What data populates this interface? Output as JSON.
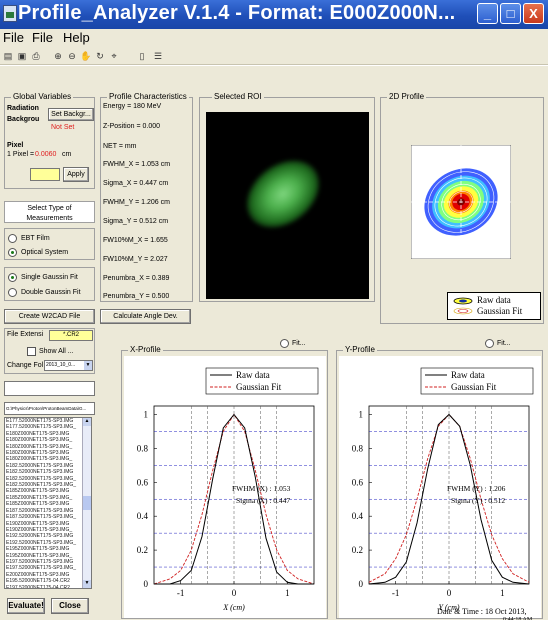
{
  "window": {
    "title": "Profile_Analyzer V.1.4 - Format: E000Z000N...",
    "buttons": [
      "_",
      "□",
      "X"
    ]
  },
  "menu": [
    "File",
    "File",
    "Help"
  ],
  "toolbar_icons": [
    "open-icon",
    "save-icon",
    "print-icon",
    "zoom-in-icon",
    "zoom-out-icon",
    "pan-icon",
    "rotate-icon",
    "data-cursor-icon",
    "colorbar-icon",
    "legend-icon"
  ],
  "global_vars": {
    "title": "Global Variables",
    "radiation": "Radiation",
    "background": "Backgrou",
    "set_bkg_btn": "Set Backgr...",
    "not_set": "Not Set",
    "pixel_label": "Pixel",
    "pixel_size_prefix": "1 Pixel = ",
    "pixel_size_value": "0.0060",
    "pixel_size_unit": "cm",
    "apply_btn": "Apply"
  },
  "measurement": {
    "title": "Select Type of Measurements",
    "ebt": "EBT Film",
    "optical": "Optical System",
    "single": "Single Gaussin Fit",
    "double": "Double Gaussin Fit"
  },
  "buttons": {
    "create_w2cad": "Create W2CAD File",
    "calc_angle": "Calculate Angle Dev.",
    "evaluate": "Evaluate!",
    "close": "Close"
  },
  "file_panel": {
    "ext_label": "File Extensi",
    "ext_value": "*.CR2",
    "show_all": "Show All ...",
    "change_folder": "Change Fol",
    "folder_value": "2013_10_0...",
    "path": "G:\\Physics\\Proton\\ProtonBeamData\\G...",
    "files": [
      "E177.52000NET175-SP3.IMG",
      "E177.52000NET175-SP3.IMG_",
      "E180Z000NET175-SP3.IMG",
      "E180Z000NET175-SP3.IMG_",
      "E180Z000NET175-SP3.IMG_",
      "E180Z000NET175-SP3.IMG",
      "E180Z000NET175-SP3.IMG_",
      "E182.52000NET175-SP3.IMG",
      "E182.52000NET175-SP3.IMG",
      "E182.52000NET175-SP3.IMG_",
      "E182.52000NET175-SP3.IMG_",
      "E185Z000NET175-SP3.IMG",
      "E185Z000NET175-SP3.IMG_",
      "E185Z000NET175-SP3.IMG",
      "E187.52000NET175-SP3.IMG",
      "E187.52000NET175-SP3.IMG_",
      "E190Z000NET175-SP3.IMG",
      "E190Z000NET175-SP3.IMG_",
      "E192.52000NET175-SP3.IMG",
      "E192.52000NET175-SP3.IMG_",
      "E195Z000NET175-SP3.IMG",
      "E195Z000NET175-SP3.IMG_",
      "E197.52000NET175-SP3.IMG",
      "E197.52000NET175-SP3.IMG_",
      "E200Z000NET175-SP3.IMG",
      "E195.52000NET175-04.CR2",
      "E197.52000NET175-04.CR2",
      "E200Z000NET175sp2-03.CR2",
      "E200Z000NET175sp2-01.CR2"
    ]
  },
  "profile_chars": {
    "title": "Profile Characteristics",
    "energy": "Energy =  180  MeV",
    "zpos": "Z-Position =  0.000",
    "net": "NET =    mm",
    "fwhm_x": "FWHM_X = 1.053   cm",
    "sigma_x": "Sigma_X = 0.447   cm",
    "fwhm_y": "FWHM_Y =  1.206   cm",
    "sigma_y": "Sigma_Y =  0.512   cm",
    "fw10_x": "FW10%M_X =  1.655",
    "fw10_y": "FW10%M_Y =  2.027",
    "penumbra_x": "Penumbra_X =  0.389",
    "penumbra_y": "Penumbra_Y =  0.500"
  },
  "roi": {
    "title": "Selected ROI"
  },
  "profile2d": {
    "title": "2D Profile",
    "legend_raw": "Raw data",
    "legend_fit": "Gaussian Fit"
  },
  "xprofile": {
    "title": "X-Profile",
    "fit_label": "Fit...",
    "legend_raw": "Raw data",
    "legend_fit": "Gaussian Fit",
    "fwhm": "FWHM (X) : 1.053",
    "sigma": "Sigma (X) : 0.447",
    "xlabel": "X (cm)"
  },
  "yprofile": {
    "title": "Y-Profile",
    "fit_label": "Fit...",
    "legend_raw": "Raw data",
    "legend_fit": "Gaussian Fit",
    "fwhm": "FWHM (Y) : 1.206",
    "sigma": "Sigma (Y) : 0.512",
    "xlabel": "Y (cm)"
  },
  "status": {
    "datetime": "Date & Time : 18 Oct 2013,",
    "time_partial": "0:44:18 AM"
  },
  "colors": {
    "accent_red": "#e02020",
    "plot_raw": "#000000",
    "plot_fit": "#d02020",
    "grid": "#2020c0"
  },
  "chart_data": [
    {
      "type": "line",
      "title": "X-Profile",
      "xlabel": "X (cm)",
      "ylabel": "",
      "xlim": [
        -1.5,
        1.5
      ],
      "ylim": [
        0,
        1.05
      ],
      "xticks": [
        -1,
        0,
        1
      ],
      "yticks": [
        0,
        0.2,
        0.4,
        0.6,
        0.8,
        1
      ],
      "series": [
        {
          "name": "Raw data",
          "x": [
            -1.5,
            -1.2,
            -1.0,
            -0.8,
            -0.6,
            -0.4,
            -0.2,
            0,
            0.2,
            0.4,
            0.6,
            0.8,
            1.0,
            1.2,
            1.5
          ],
          "y": [
            0.0,
            0.0,
            0.02,
            0.08,
            0.28,
            0.62,
            0.92,
            1.0,
            0.92,
            0.63,
            0.27,
            0.07,
            0.01,
            0.0,
            0.0
          ]
        },
        {
          "name": "Gaussian Fit",
          "x": [
            -1.5,
            -1.2,
            -1.0,
            -0.8,
            -0.6,
            -0.4,
            -0.2,
            0,
            0.2,
            0.4,
            0.6,
            0.8,
            1.0,
            1.2,
            1.5
          ],
          "y": [
            0.0,
            0.03,
            0.08,
            0.2,
            0.41,
            0.67,
            0.9,
            1.0,
            0.9,
            0.67,
            0.41,
            0.2,
            0.08,
            0.03,
            0.0
          ]
        }
      ]
    },
    {
      "type": "line",
      "title": "Y-Profile",
      "xlabel": "Y (cm)",
      "ylabel": "",
      "xlim": [
        -1.5,
        1.5
      ],
      "ylim": [
        0,
        1.05
      ],
      "xticks": [
        -1,
        0,
        1
      ],
      "yticks": [
        0,
        0.2,
        0.4,
        0.6,
        0.8,
        1
      ],
      "series": [
        {
          "name": "Raw data",
          "x": [
            -1.5,
            -1.2,
            -1.0,
            -0.8,
            -0.6,
            -0.4,
            -0.2,
            0,
            0.2,
            0.4,
            0.6,
            0.8,
            1.0,
            1.2,
            1.5
          ],
          "y": [
            0.0,
            0.01,
            0.04,
            0.13,
            0.36,
            0.68,
            0.94,
            1.0,
            0.93,
            0.7,
            0.38,
            0.14,
            0.04,
            0.01,
            0.0
          ]
        },
        {
          "name": "Gaussian Fit",
          "x": [
            -1.5,
            -1.2,
            -1.0,
            -0.8,
            -0.6,
            -0.4,
            -0.2,
            0,
            0.2,
            0.4,
            0.6,
            0.8,
            1.0,
            1.2,
            1.5
          ],
          "y": [
            0.01,
            0.06,
            0.15,
            0.29,
            0.5,
            0.74,
            0.93,
            1.0,
            0.93,
            0.74,
            0.5,
            0.29,
            0.15,
            0.06,
            0.01
          ]
        }
      ]
    }
  ]
}
